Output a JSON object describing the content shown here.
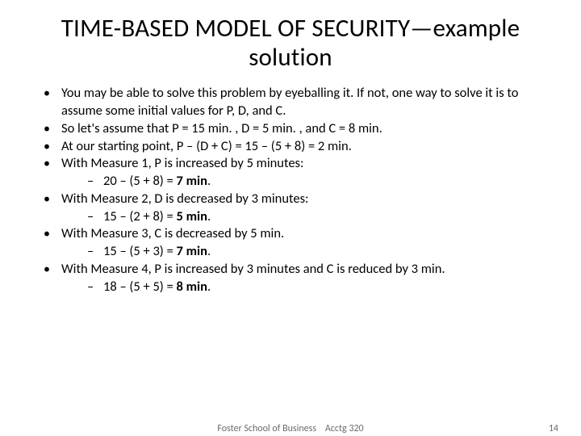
{
  "title": "TIME-BASED MODEL OF SECURITY—example  solution",
  "bullets": [
    {
      "text": "You may be able to solve this problem by eyeballing it. If not, one way to solve it is to assume some initial values for P, D, and C."
    },
    {
      "text": "So let's assume that P = 15 min. , D = 5 min. , and C = 8 min."
    },
    {
      "text": "At our starting point, P – (D + C) = 15 – (5 + 8) = 2 min."
    },
    {
      "text": "With Measure 1, P is increased by 5 minutes:",
      "sub": {
        "prefix": " 20 – (5 + 8) = ",
        "bold": "7 min",
        "suffix": "."
      }
    },
    {
      "text": "With Measure 2, D is decreased by 3 minutes:",
      "sub": {
        "prefix": " 15 – (2 + 8) = ",
        "bold": "5 min",
        "suffix": "."
      }
    },
    {
      "text": "With Measure 3, C is decreased by 5 min.",
      "sub": {
        "prefix": " 15 – (5 + 3) = ",
        "bold": "7 min",
        "suffix": "."
      }
    },
    {
      "text": "With Measure 4, P is increased by 3 minutes and C is reduced by 3 min.",
      "sub": {
        "prefix": " 18 – (5 + 5) = ",
        "bold": "8 min",
        "suffix": "."
      }
    }
  ],
  "footer": {
    "center_left": "Foster School of Business",
    "center_right": "Acctg 320",
    "page": "14"
  }
}
